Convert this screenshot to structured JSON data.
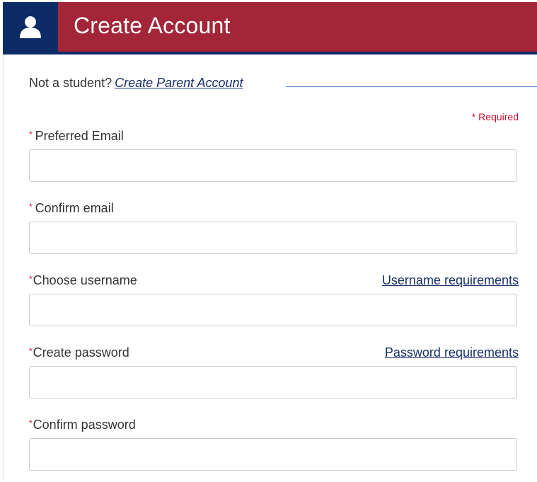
{
  "header": {
    "title": "Create Account",
    "icon": "user-icon",
    "colors": {
      "navy": "#0d2b66",
      "crimson": "#a32638"
    }
  },
  "intro": {
    "text": "Not a student?",
    "link": "Create Parent Account"
  },
  "required_note": "* Required",
  "fields": [
    {
      "label": "Preferred Email",
      "star": "*",
      "value": "",
      "placeholder": ""
    },
    {
      "label": "Confirm email",
      "star": "*",
      "value": "",
      "placeholder": ""
    },
    {
      "label": "Choose username",
      "star": "*",
      "value": "",
      "placeholder": "",
      "link": "Username requirements"
    },
    {
      "label": "Create password",
      "star": "*",
      "value": "",
      "placeholder": "",
      "link": "Password requirements"
    },
    {
      "label": "Confirm password",
      "star": "*",
      "value": "",
      "placeholder": ""
    }
  ]
}
